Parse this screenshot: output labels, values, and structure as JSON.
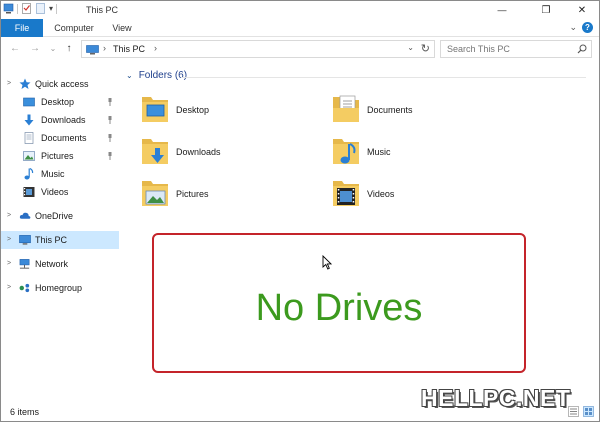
{
  "titlebar": {
    "title": "This PC",
    "qat_dropdown": "▾",
    "minimize": "—",
    "restore": "❐",
    "close": "✕"
  },
  "ribbon": {
    "tabs": [
      {
        "label": "File"
      },
      {
        "label": "Computer"
      },
      {
        "label": "View"
      }
    ],
    "expand": "⌄",
    "help": "?"
  },
  "address": {
    "back": "←",
    "forward": "→",
    "recent": "⌄",
    "up": "↑",
    "separator": "›",
    "location": "This PC",
    "dropdown": "⌄",
    "refresh": "↻",
    "search_placeholder": "Search This PC"
  },
  "navigation": {
    "quick_access": {
      "label": "Quick access",
      "icon": "star-icon"
    },
    "pinned": [
      {
        "label": "Desktop",
        "icon": "desktop-folder-icon",
        "pinned": true
      },
      {
        "label": "Downloads",
        "icon": "download-arrow-icon",
        "pinned": true
      },
      {
        "label": "Documents",
        "icon": "documents-folder-icon",
        "pinned": true
      },
      {
        "label": "Pictures",
        "icon": "pictures-folder-icon",
        "pinned": true
      },
      {
        "label": "Music",
        "icon": "music-note-icon",
        "pinned": false
      },
      {
        "label": "Videos",
        "icon": "videos-folder-icon",
        "pinned": false
      }
    ],
    "onedrive": {
      "label": "OneDrive",
      "icon": "cloud-icon"
    },
    "thispc": {
      "label": "This PC",
      "icon": "computer-icon",
      "selected": true
    },
    "network": {
      "label": "Network",
      "icon": "network-icon"
    },
    "homegroup": {
      "label": "Homegroup",
      "icon": "homegroup-icon"
    },
    "chevron": ">"
  },
  "content": {
    "group_chevron": "⌄",
    "group_title": "Folders (6)",
    "folders": [
      {
        "name": "Desktop",
        "icon": "desktop-folder-icon"
      },
      {
        "name": "Documents",
        "icon": "documents-folder-icon"
      },
      {
        "name": "Downloads",
        "icon": "downloads-folder-icon"
      },
      {
        "name": "Music",
        "icon": "music-folder-icon"
      },
      {
        "name": "Pictures",
        "icon": "pictures-folder-icon"
      },
      {
        "name": "Videos",
        "icon": "videos-folder-icon"
      }
    ]
  },
  "overlay": {
    "text": "No Drives",
    "border_color": "#c4242a",
    "text_color": "#3c9a1e"
  },
  "status": {
    "item_count": "6 items"
  },
  "watermark": "HELLPC.NET",
  "colors": {
    "accent": "#1979ca",
    "selection": "#cce8ff",
    "folder_yellow": "#f4cc62"
  }
}
